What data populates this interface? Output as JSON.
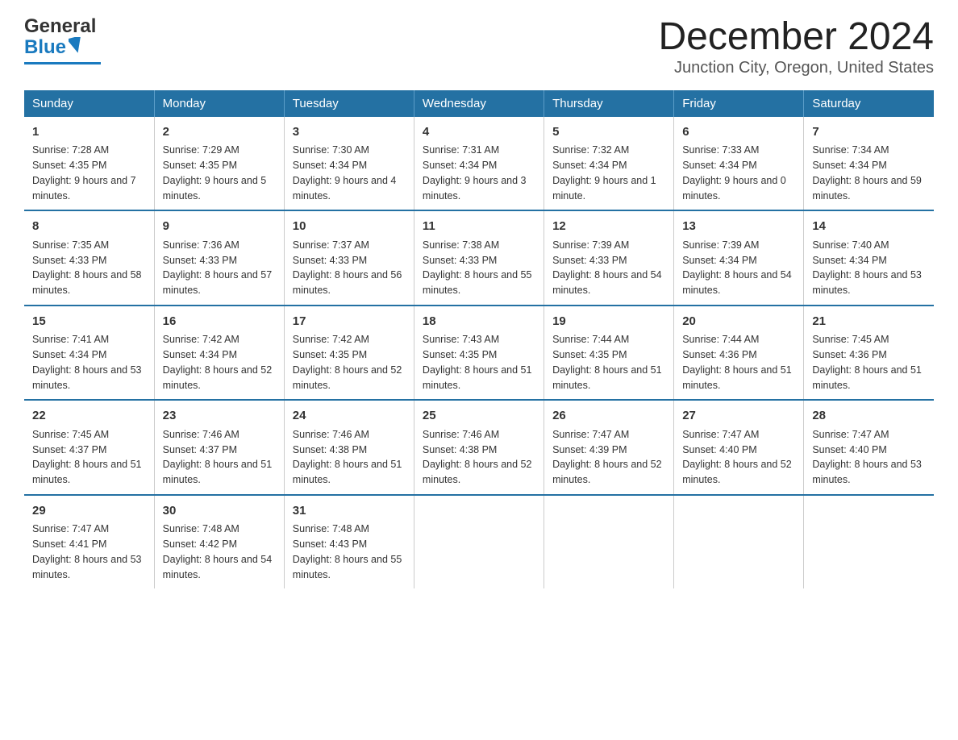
{
  "header": {
    "logo_general": "General",
    "logo_blue": "Blue",
    "month_year": "December 2024",
    "location": "Junction City, Oregon, United States"
  },
  "days_of_week": [
    "Sunday",
    "Monday",
    "Tuesday",
    "Wednesday",
    "Thursday",
    "Friday",
    "Saturday"
  ],
  "weeks": [
    [
      {
        "day": "1",
        "sunrise": "7:28 AM",
        "sunset": "4:35 PM",
        "daylight": "9 hours and 7 minutes."
      },
      {
        "day": "2",
        "sunrise": "7:29 AM",
        "sunset": "4:35 PM",
        "daylight": "9 hours and 5 minutes."
      },
      {
        "day": "3",
        "sunrise": "7:30 AM",
        "sunset": "4:34 PM",
        "daylight": "9 hours and 4 minutes."
      },
      {
        "day": "4",
        "sunrise": "7:31 AM",
        "sunset": "4:34 PM",
        "daylight": "9 hours and 3 minutes."
      },
      {
        "day": "5",
        "sunrise": "7:32 AM",
        "sunset": "4:34 PM",
        "daylight": "9 hours and 1 minute."
      },
      {
        "day": "6",
        "sunrise": "7:33 AM",
        "sunset": "4:34 PM",
        "daylight": "9 hours and 0 minutes."
      },
      {
        "day": "7",
        "sunrise": "7:34 AM",
        "sunset": "4:34 PM",
        "daylight": "8 hours and 59 minutes."
      }
    ],
    [
      {
        "day": "8",
        "sunrise": "7:35 AM",
        "sunset": "4:33 PM",
        "daylight": "8 hours and 58 minutes."
      },
      {
        "day": "9",
        "sunrise": "7:36 AM",
        "sunset": "4:33 PM",
        "daylight": "8 hours and 57 minutes."
      },
      {
        "day": "10",
        "sunrise": "7:37 AM",
        "sunset": "4:33 PM",
        "daylight": "8 hours and 56 minutes."
      },
      {
        "day": "11",
        "sunrise": "7:38 AM",
        "sunset": "4:33 PM",
        "daylight": "8 hours and 55 minutes."
      },
      {
        "day": "12",
        "sunrise": "7:39 AM",
        "sunset": "4:33 PM",
        "daylight": "8 hours and 54 minutes."
      },
      {
        "day": "13",
        "sunrise": "7:39 AM",
        "sunset": "4:34 PM",
        "daylight": "8 hours and 54 minutes."
      },
      {
        "day": "14",
        "sunrise": "7:40 AM",
        "sunset": "4:34 PM",
        "daylight": "8 hours and 53 minutes."
      }
    ],
    [
      {
        "day": "15",
        "sunrise": "7:41 AM",
        "sunset": "4:34 PM",
        "daylight": "8 hours and 53 minutes."
      },
      {
        "day": "16",
        "sunrise": "7:42 AM",
        "sunset": "4:34 PM",
        "daylight": "8 hours and 52 minutes."
      },
      {
        "day": "17",
        "sunrise": "7:42 AM",
        "sunset": "4:35 PM",
        "daylight": "8 hours and 52 minutes."
      },
      {
        "day": "18",
        "sunrise": "7:43 AM",
        "sunset": "4:35 PM",
        "daylight": "8 hours and 51 minutes."
      },
      {
        "day": "19",
        "sunrise": "7:44 AM",
        "sunset": "4:35 PM",
        "daylight": "8 hours and 51 minutes."
      },
      {
        "day": "20",
        "sunrise": "7:44 AM",
        "sunset": "4:36 PM",
        "daylight": "8 hours and 51 minutes."
      },
      {
        "day": "21",
        "sunrise": "7:45 AM",
        "sunset": "4:36 PM",
        "daylight": "8 hours and 51 minutes."
      }
    ],
    [
      {
        "day": "22",
        "sunrise": "7:45 AM",
        "sunset": "4:37 PM",
        "daylight": "8 hours and 51 minutes."
      },
      {
        "day": "23",
        "sunrise": "7:46 AM",
        "sunset": "4:37 PM",
        "daylight": "8 hours and 51 minutes."
      },
      {
        "day": "24",
        "sunrise": "7:46 AM",
        "sunset": "4:38 PM",
        "daylight": "8 hours and 51 minutes."
      },
      {
        "day": "25",
        "sunrise": "7:46 AM",
        "sunset": "4:38 PM",
        "daylight": "8 hours and 52 minutes."
      },
      {
        "day": "26",
        "sunrise": "7:47 AM",
        "sunset": "4:39 PM",
        "daylight": "8 hours and 52 minutes."
      },
      {
        "day": "27",
        "sunrise": "7:47 AM",
        "sunset": "4:40 PM",
        "daylight": "8 hours and 52 minutes."
      },
      {
        "day": "28",
        "sunrise": "7:47 AM",
        "sunset": "4:40 PM",
        "daylight": "8 hours and 53 minutes."
      }
    ],
    [
      {
        "day": "29",
        "sunrise": "7:47 AM",
        "sunset": "4:41 PM",
        "daylight": "8 hours and 53 minutes."
      },
      {
        "day": "30",
        "sunrise": "7:48 AM",
        "sunset": "4:42 PM",
        "daylight": "8 hours and 54 minutes."
      },
      {
        "day": "31",
        "sunrise": "7:48 AM",
        "sunset": "4:43 PM",
        "daylight": "8 hours and 55 minutes."
      },
      null,
      null,
      null,
      null
    ]
  ],
  "labels": {
    "sunrise": "Sunrise:",
    "sunset": "Sunset:",
    "daylight": "Daylight:"
  }
}
